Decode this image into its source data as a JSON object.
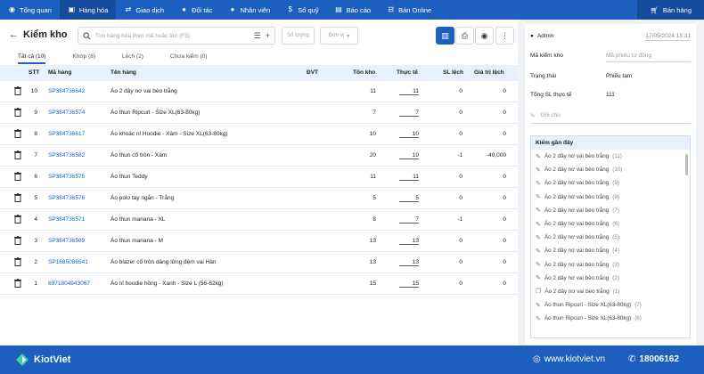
{
  "nav": {
    "items": [
      {
        "label": "Tổng quan",
        "icon": "eye-icon"
      },
      {
        "label": "Hàng hóa",
        "icon": "box-icon"
      },
      {
        "label": "Giao dịch",
        "icon": "exchange-icon"
      },
      {
        "label": "Đối tác",
        "icon": "user-icon"
      },
      {
        "label": "Nhân viên",
        "icon": "users-icon"
      },
      {
        "label": "Sổ quỹ",
        "icon": "coin-icon"
      },
      {
        "label": "Báo cáo",
        "icon": "report-icon"
      },
      {
        "label": "Bán Online",
        "icon": "cart-icon"
      }
    ],
    "sell_label": "Bán hàng"
  },
  "page": {
    "title": "Kiểm kho",
    "search_placeholder": "Tìm hàng hóa theo mã hoặc tên (F3)",
    "qty_placeholder": "Số lượng",
    "unit_placeholder": "Đơn vị"
  },
  "tabs": [
    "Tất cả (10)",
    "Khớp (8)",
    "Lệch (2)",
    "Chưa kiểm (0)"
  ],
  "columns": {
    "stt": "STT",
    "code": "Mã hàng",
    "name": "Tên hàng",
    "unit": "ĐVT",
    "stock": "Tồn kho",
    "real": "Thực tế",
    "diff": "SL lệch",
    "value": "Giá trị lệch"
  },
  "rows": [
    {
      "stt": "10",
      "code": "SP384736642",
      "name": "Áo 2 dây nơ vai bèo trắng",
      "unit": "",
      "stock": "11",
      "real": "11",
      "diff": "0",
      "value": "0"
    },
    {
      "stt": "9",
      "code": "SP384736574",
      "name": "Áo thun Ripcurl - Size XL(63-80kg)",
      "unit": "",
      "stock": "7",
      "real": "7",
      "diff": "0",
      "value": "0"
    },
    {
      "stt": "8",
      "code": "SP384736617",
      "name": "Áo khoác nỉ Hoodie - Xám - Size XL(63-80kg)",
      "unit": "",
      "stock": "10",
      "real": "10",
      "diff": "0",
      "value": "0"
    },
    {
      "stt": "7",
      "code": "SP384736582",
      "name": "Áo thun cổ tròn - Xám",
      "unit": "",
      "stock": "20",
      "real": "19",
      "diff": "-1",
      "value": "-40,000"
    },
    {
      "stt": "6",
      "code": "SP384736575",
      "name": "Áo thun Teddy",
      "unit": "",
      "stock": "11",
      "real": "11",
      "diff": "0",
      "value": "0"
    },
    {
      "stt": "5",
      "code": "SP384736576",
      "name": "Áo polo tay ngắn - Trắng",
      "unit": "",
      "stock": "5",
      "real": "5",
      "diff": "0",
      "value": "0"
    },
    {
      "stt": "4",
      "code": "SP384736571",
      "name": "Áo thun mariana - XL",
      "unit": "",
      "stock": "8",
      "real": "7",
      "diff": "-1",
      "value": "0"
    },
    {
      "stt": "3",
      "code": "SP384736569",
      "name": "Áo thun mariana - M",
      "unit": "",
      "stock": "13",
      "real": "13",
      "diff": "0",
      "value": "0"
    },
    {
      "stt": "2",
      "code": "SP1685086541",
      "name": "Áo blazer cổ tròn dáng lửng đệm vai Hàn",
      "unit": "",
      "stock": "13",
      "real": "13",
      "diff": "0",
      "value": "0"
    },
    {
      "stt": "1",
      "code": "6971804943067",
      "name": "Áo nỉ hoodie hồng - Xanh - Size L (56-62kg)",
      "unit": "",
      "stock": "15",
      "real": "15",
      "diff": "0",
      "value": "0"
    }
  ],
  "side": {
    "admin": "Admin",
    "date": "17/05/2024 15:31",
    "code_label": "Mã kiểm kho",
    "code_placeholder": "Mã phiếu tự động",
    "status_label": "Trạng thái",
    "status_value": "Phiếu tạm",
    "total_label": "Tổng SL thực tế",
    "total_value": "111",
    "note_placeholder": "Ghi chú",
    "recent_title": "Kiểm gần đây",
    "recent": [
      {
        "name": "Áo 2 dây nơ vai bèo trắng",
        "count": "(11)"
      },
      {
        "name": "Áo 2 dây nơ vai bèo trắng",
        "count": "(10)"
      },
      {
        "name": "Áo 2 dây nơ vai bèo trắng",
        "count": "(9)"
      },
      {
        "name": "Áo 2 dây nơ vai bèo trắng",
        "count": "(8)"
      },
      {
        "name": "Áo 2 dây nơ vai bèo trắng",
        "count": "(7)"
      },
      {
        "name": "Áo 2 dây nơ vai bèo trắng",
        "count": "(6)"
      },
      {
        "name": "Áo 2 dây nơ vai bèo trắng",
        "count": "(5)"
      },
      {
        "name": "Áo 2 dây nơ vai bèo trắng",
        "count": "(4)"
      },
      {
        "name": "Áo 2 dây nơ vai bèo trắng",
        "count": "(3)"
      },
      {
        "name": "Áo 2 dây nơ vai bèo trắng",
        "count": "(2)"
      },
      {
        "name": "Áo 2 dây nơ vai bèo trắng",
        "count": "(1)"
      },
      {
        "name": "Áo thun Ripcurl - Size XL(63-80kg)",
        "count": "(7)"
      },
      {
        "name": "Áo thun Ripcurl - Size XL(63-80kg)",
        "count": "(6)"
      }
    ]
  },
  "footer": {
    "brand": "KiotViet",
    "site": "www.kiotviet.vn",
    "phone": "18006162"
  },
  "colors": {
    "primary": "#1d5fbf",
    "header_bg": "#e8f0fb"
  }
}
